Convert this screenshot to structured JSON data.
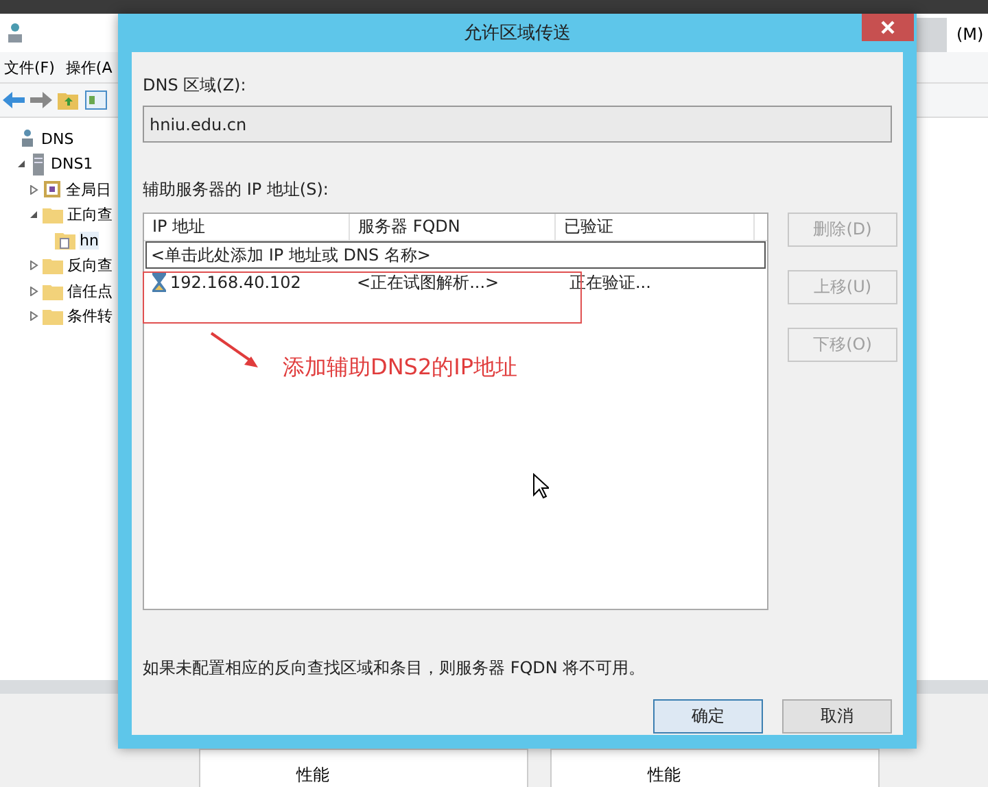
{
  "background_window": {
    "menu": [
      "文件(F)",
      "操作(A"
    ],
    "right_menu": "(M)",
    "tree": [
      {
        "label": "DNS",
        "kind": "dns",
        "children": [
          {
            "label": "DNS1",
            "kind": "server",
            "expanded": true,
            "children": [
              {
                "label": "全局日",
                "kind": "log",
                "expanded": false
              },
              {
                "label": "正向查",
                "kind": "folder",
                "expanded": true,
                "children": [
                  {
                    "label": "hn",
                    "kind": "zone",
                    "selected": true
                  }
                ]
              },
              {
                "label": "反向查",
                "kind": "folder",
                "expanded": false
              },
              {
                "label": "信任点",
                "kind": "folder",
                "expanded": false
              },
              {
                "label": "条件转",
                "kind": "folder",
                "expanded": false
              }
            ]
          }
        ]
      }
    ],
    "panels": [
      "性能",
      "性能"
    ]
  },
  "dialog": {
    "title": "允许区域传送",
    "zone_label": "DNS 区域(Z):",
    "zone_value": "hniu.edu.cn",
    "servers_label": "辅助服务器的 IP 地址(S):",
    "columns": [
      "IP 地址",
      "服务器 FQDN",
      "已验证"
    ],
    "add_row": {
      "placeholder": "<单击此处添加 IP 地址或 DNS 名称>"
    },
    "rows": [
      {
        "ip": "192.168.40.102",
        "fqdn": "<正在试图解析...>",
        "validated": "正在验证..."
      }
    ],
    "side_buttons": [
      {
        "label": "删除(D)",
        "disabled": true
      },
      {
        "label": "上移(U)",
        "disabled": true
      },
      {
        "label": "下移(O)",
        "disabled": true
      }
    ],
    "note": "如果未配置相应的反向查找区域和条目，则服务器 FQDN 将不可用。",
    "buttons": [
      {
        "label": "确定",
        "default": true
      },
      {
        "label": "取消",
        "default": false
      }
    ]
  },
  "annotation": {
    "text": "添加辅助DNS2的IP地址"
  }
}
